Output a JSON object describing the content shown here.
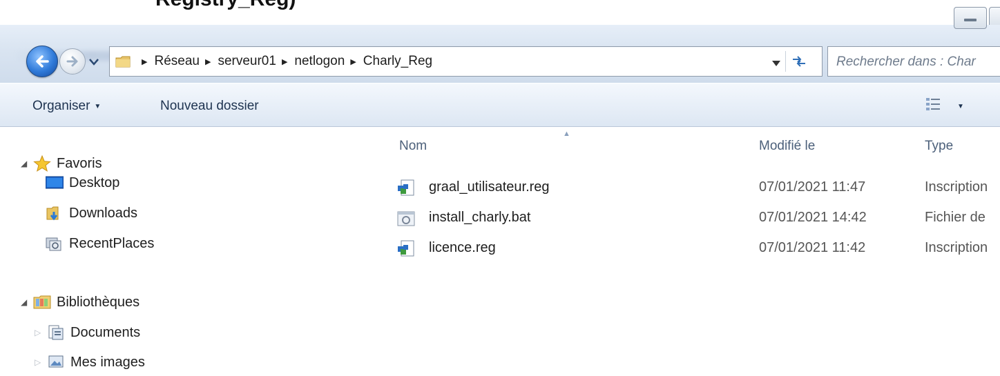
{
  "window": {
    "title_fragment": "Registry_Reg)"
  },
  "address_bar": {
    "crumbs": [
      "Réseau",
      "serveur01",
      "netlogon",
      "Charly_Reg"
    ]
  },
  "search": {
    "placeholder": "Rechercher dans : Char"
  },
  "toolbar": {
    "organize_label": "Organiser",
    "new_folder_label": "Nouveau dossier"
  },
  "sidebar": {
    "favorites_label": "Favoris",
    "items": [
      {
        "label": "Desktop",
        "icon": "desktop-icon"
      },
      {
        "label": "Downloads",
        "icon": "downloads-folder-icon"
      },
      {
        "label": "RecentPlaces",
        "icon": "recent-places-icon"
      }
    ],
    "libraries_label": "Bibliothèques",
    "libraries": [
      {
        "label": "Documents",
        "icon": "documents-library-icon"
      },
      {
        "label": "Mes images",
        "icon": "pictures-library-icon"
      }
    ]
  },
  "columns": {
    "name": "Nom",
    "modified": "Modifié le",
    "type": "Type"
  },
  "files": [
    {
      "name": "graal_utilisateur.reg",
      "modified": "07/01/2021 11:47",
      "type": "Inscription",
      "icon": "registry-file-icon"
    },
    {
      "name": "install_charly.bat",
      "modified": "07/01/2021 14:42",
      "type": "Fichier de",
      "icon": "batch-file-icon"
    },
    {
      "name": "licence.reg",
      "modified": "07/01/2021 11:42",
      "type": "Inscription",
      "icon": "registry-file-icon"
    }
  ],
  "colors": {
    "nav_gradient_top": "#e6eef8",
    "toolbar_text": "#1e3350",
    "column_header_text": "#4c607a"
  }
}
